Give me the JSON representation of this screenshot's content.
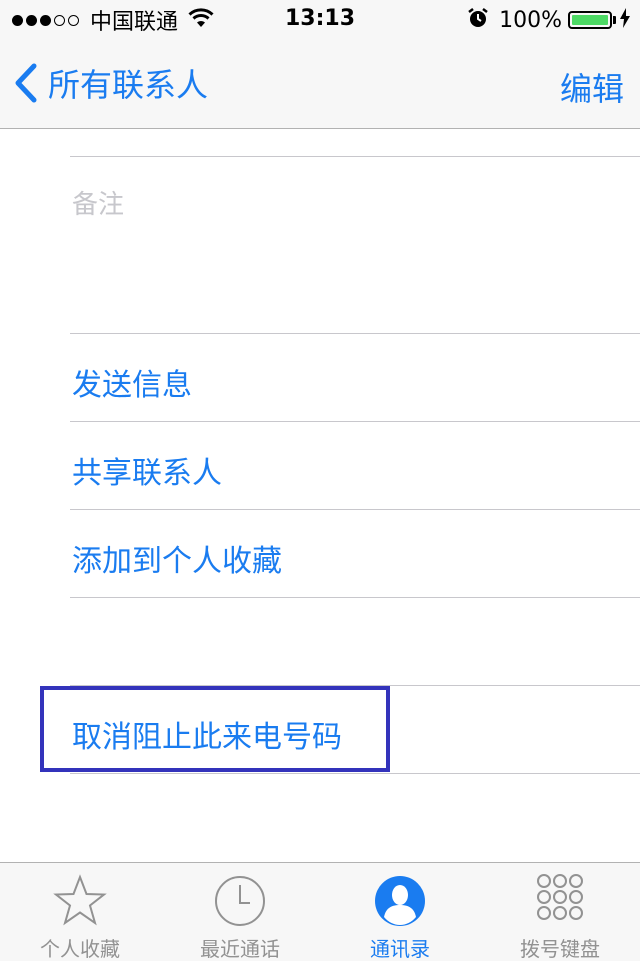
{
  "status_bar": {
    "carrier": "中国联通",
    "time": "13:13",
    "battery": "100%",
    "battery_color": "#4cd964"
  },
  "nav": {
    "back_label": "所有联系人",
    "edit_label": "编辑"
  },
  "contact": {
    "notes_label": "备注",
    "actions": [
      "发送信息",
      "共享联系人",
      "添加到个人收藏"
    ],
    "unblock_label": "取消阻止此来电号码"
  },
  "tab_bar": {
    "tabs": [
      {
        "label": "个人收藏",
        "icon": "star-icon",
        "active": false
      },
      {
        "label": "最近通话",
        "icon": "clock-icon",
        "active": false
      },
      {
        "label": "通讯录",
        "icon": "contacts-icon",
        "active": true
      },
      {
        "label": "拨号键盘",
        "icon": "keypad-icon",
        "active": false
      }
    ]
  },
  "colors": {
    "accent": "#1a7cf0",
    "highlight_border": "#3333bb"
  }
}
